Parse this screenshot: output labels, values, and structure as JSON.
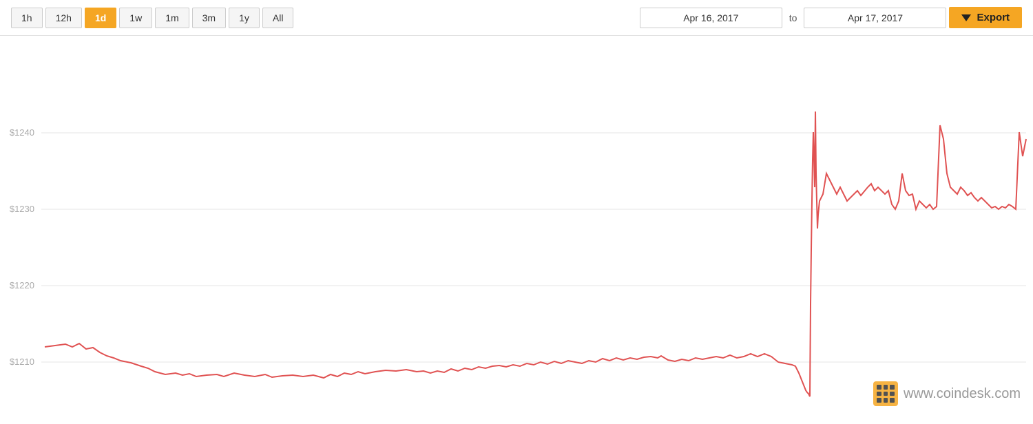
{
  "toolbar": {
    "time_buttons": [
      {
        "label": "1h",
        "active": false
      },
      {
        "label": "12h",
        "active": false
      },
      {
        "label": "1d",
        "active": true
      },
      {
        "label": "1w",
        "active": false
      },
      {
        "label": "1m",
        "active": false
      },
      {
        "label": "3m",
        "active": false
      },
      {
        "label": "1y",
        "active": false
      },
      {
        "label": "All",
        "active": false
      }
    ],
    "date_from": "Apr 16, 2017",
    "date_to": "Apr 17, 2017",
    "date_separator": "to",
    "export_label": "Export"
  },
  "chart": {
    "y_labels": [
      "$1240",
      "$1230",
      "$1220",
      "$1210"
    ],
    "watermark_text": "www.coindesk.com"
  }
}
